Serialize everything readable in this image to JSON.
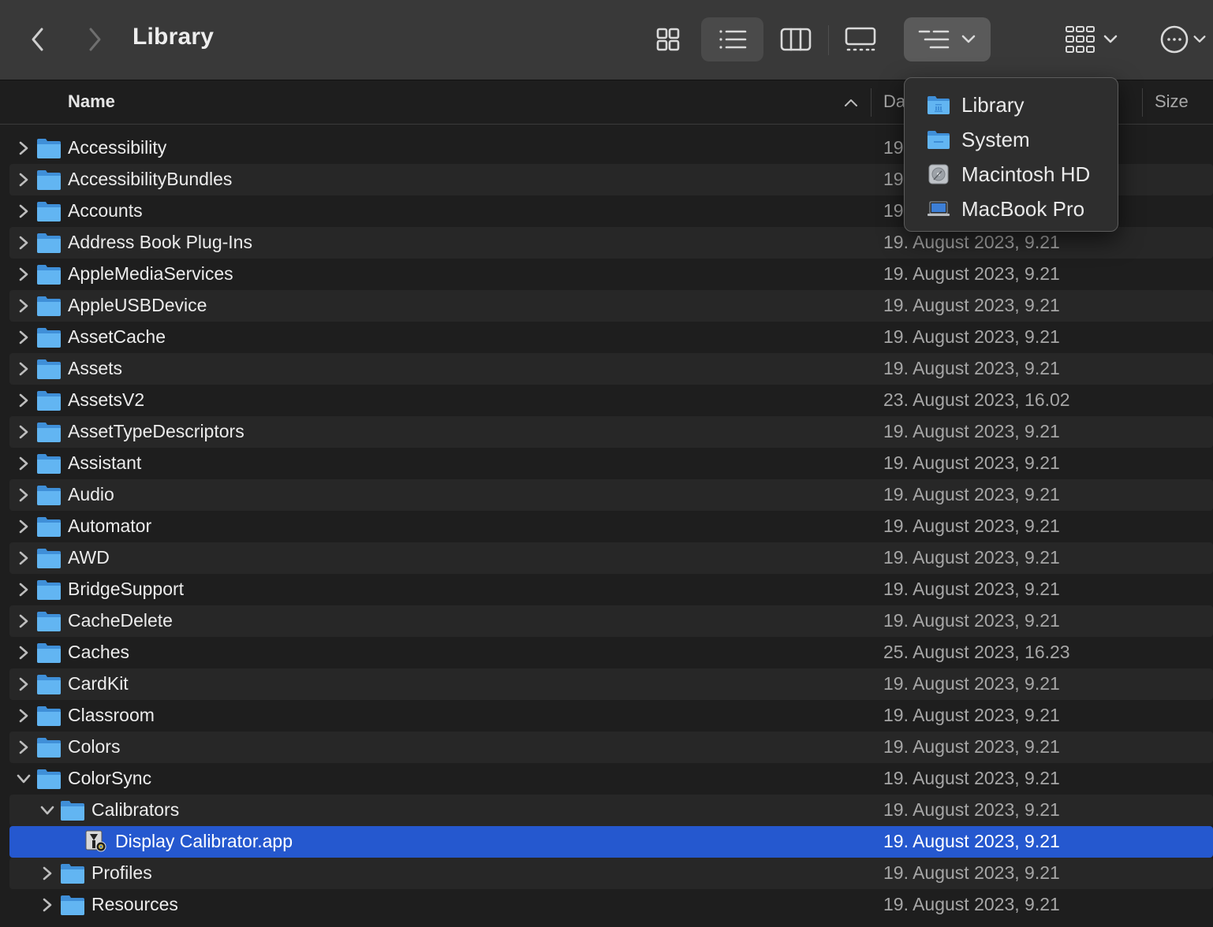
{
  "window": {
    "title": "Library"
  },
  "toolbar": {
    "back_icon": "chevron-left-icon",
    "forward_icon": "chevron-right-icon",
    "views": [
      "icon-view",
      "list-view",
      "column-view",
      "gallery-view"
    ],
    "active_view": "list-view",
    "path_popup_icon": "path-list-icon",
    "group_icon": "group-by-icon",
    "more_icon": "ellipsis-circle-icon"
  },
  "header": {
    "name_label": "Name",
    "date_label": "Da",
    "size_label": "Size",
    "sort_direction": "ascending"
  },
  "path_menu": {
    "items": [
      {
        "label": "Library",
        "icon": "library-folder-icon"
      },
      {
        "label": "System",
        "icon": "system-folder-icon"
      },
      {
        "label": "Macintosh HD",
        "icon": "hard-drive-icon"
      },
      {
        "label": "MacBook Pro",
        "icon": "laptop-icon"
      }
    ]
  },
  "rows": [
    {
      "name": "Accessibility",
      "date": "19",
      "level": 0,
      "expanded": false,
      "kind": "folder"
    },
    {
      "name": "AccessibilityBundles",
      "date": "19",
      "level": 0,
      "expanded": false,
      "kind": "folder"
    },
    {
      "name": "Accounts",
      "date": "19",
      "level": 0,
      "expanded": false,
      "kind": "folder"
    },
    {
      "name": "Address Book Plug-Ins",
      "date": "19. August 2023, 9.21",
      "level": 0,
      "expanded": false,
      "kind": "folder"
    },
    {
      "name": "AppleMediaServices",
      "date": "19. August 2023, 9.21",
      "level": 0,
      "expanded": false,
      "kind": "folder"
    },
    {
      "name": "AppleUSBDevice",
      "date": "19. August 2023, 9.21",
      "level": 0,
      "expanded": false,
      "kind": "folder"
    },
    {
      "name": "AssetCache",
      "date": "19. August 2023, 9.21",
      "level": 0,
      "expanded": false,
      "kind": "folder"
    },
    {
      "name": "Assets",
      "date": "19. August 2023, 9.21",
      "level": 0,
      "expanded": false,
      "kind": "folder"
    },
    {
      "name": "AssetsV2",
      "date": "23. August 2023, 16.02",
      "level": 0,
      "expanded": false,
      "kind": "folder"
    },
    {
      "name": "AssetTypeDescriptors",
      "date": "19. August 2023, 9.21",
      "level": 0,
      "expanded": false,
      "kind": "folder"
    },
    {
      "name": "Assistant",
      "date": "19. August 2023, 9.21",
      "level": 0,
      "expanded": false,
      "kind": "folder"
    },
    {
      "name": "Audio",
      "date": "19. August 2023, 9.21",
      "level": 0,
      "expanded": false,
      "kind": "folder"
    },
    {
      "name": "Automator",
      "date": "19. August 2023, 9.21",
      "level": 0,
      "expanded": false,
      "kind": "folder"
    },
    {
      "name": "AWD",
      "date": "19. August 2023, 9.21",
      "level": 0,
      "expanded": false,
      "kind": "folder"
    },
    {
      "name": "BridgeSupport",
      "date": "19. August 2023, 9.21",
      "level": 0,
      "expanded": false,
      "kind": "folder"
    },
    {
      "name": "CacheDelete",
      "date": "19. August 2023, 9.21",
      "level": 0,
      "expanded": false,
      "kind": "folder"
    },
    {
      "name": "Caches",
      "date": "25. August 2023, 16.23",
      "level": 0,
      "expanded": false,
      "kind": "folder"
    },
    {
      "name": "CardKit",
      "date": "19. August 2023, 9.21",
      "level": 0,
      "expanded": false,
      "kind": "folder"
    },
    {
      "name": "Classroom",
      "date": "19. August 2023, 9.21",
      "level": 0,
      "expanded": false,
      "kind": "folder"
    },
    {
      "name": "Colors",
      "date": "19. August 2023, 9.21",
      "level": 0,
      "expanded": false,
      "kind": "folder"
    },
    {
      "name": "ColorSync",
      "date": "19. August 2023, 9.21",
      "level": 0,
      "expanded": true,
      "kind": "folder"
    },
    {
      "name": "Calibrators",
      "date": "19. August 2023, 9.21",
      "level": 1,
      "expanded": true,
      "kind": "folder"
    },
    {
      "name": "Display Calibrator.app",
      "date": "19. August 2023, 9.21",
      "level": 2,
      "expanded": null,
      "kind": "app",
      "selected": true
    },
    {
      "name": "Profiles",
      "date": "19. August 2023, 9.21",
      "level": 1,
      "expanded": false,
      "kind": "folder"
    },
    {
      "name": "Resources",
      "date": "19. August 2023, 9.21",
      "level": 1,
      "expanded": false,
      "kind": "folder"
    }
  ],
  "colors": {
    "accent": "#2558cf",
    "folder": "#5fb3f0",
    "toolbar": "#393939",
    "background": "#1e1e1e"
  }
}
